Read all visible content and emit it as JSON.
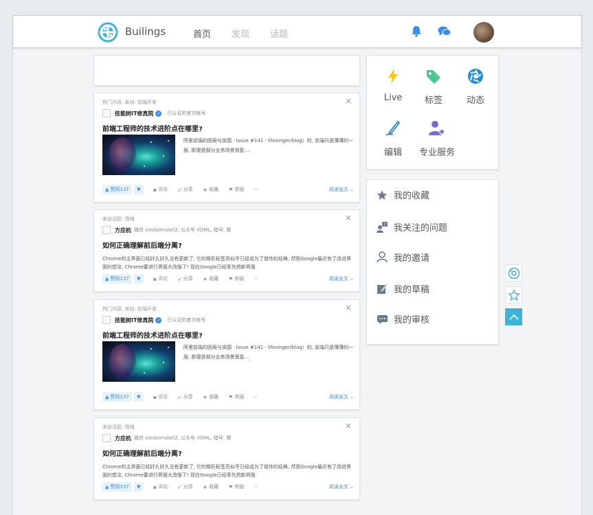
{
  "header": {
    "brand": "Builings",
    "nav": [
      "首页",
      "发现",
      "话题"
    ],
    "icons": [
      "bell-icon",
      "chat-icon"
    ],
    "accent": "#3cb3d9"
  },
  "feed": [
    {
      "meta": "热门内容, 来自: 前端开发",
      "author": "技能树IT修真院",
      "author_desc": "已认证的官方帐号",
      "title": "前端工程师的技术进阶点在哪里?",
      "excerpt": "阿里前端的困局与突围 · Issue #141 · lifesinger/blog）的, 前端只是薄薄的一层, 即便是部分业务场景很复…",
      "has_image": true,
      "vote": "赞同137",
      "comment": "评论",
      "share": "分享",
      "favorite": "收藏",
      "report": "举报",
      "more": "···",
      "read_all": "阅读全文"
    },
    {
      "meta": "来自话题: 情绪",
      "author": "方应杭",
      "author_desc": "微信 xiedaimala02, 公众号 XDML, 暗号: 飓",
      "title": "如何正确理解前后端分离?",
      "excerpt": "Chrome的主界面已经好久好久没有更新了, 它的梯形标签页似乎已经成为了祖传的经典, 然而Google最近有了改进界面的想法, Chrome要进行界面大改版了! 现在Google已经率先把新界面",
      "has_image": false,
      "vote": "赞同137",
      "comment": "评论",
      "share": "分享",
      "favorite": "收藏",
      "report": "举报",
      "more": "···",
      "read_all": "阅读全文"
    },
    {
      "meta": "热门内容, 来自: 前端开发",
      "author": "技能树IT修真院",
      "author_desc": "已认证的官方帐号",
      "title": "前端工程师的技术进阶点在哪里?",
      "excerpt": "阿里前端的困局与突围 · Issue #141 · lifesinger/blog）的, 前端只是薄薄的一层, 即便是部分业务场景很复…",
      "has_image": true,
      "vote": "赞同137",
      "comment": "评论",
      "share": "分享",
      "favorite": "收藏",
      "report": "举报",
      "more": "···",
      "read_all": "阅读全文"
    },
    {
      "meta": "来自话题: 情绪",
      "author": "方应杭",
      "author_desc": "微信 xiedaimala02, 公众号 XDML, 暗号: 飓",
      "title": "如何正确理解前后端分离?",
      "excerpt": "Chrome的主界面已经好久好久没有更新了, 它的梯形标签页似乎已经成为了祖传的经典, 然而Google最近有了改进界面的想法, Chrome要进行界面大改版了! 现在Google已经率先把新界面",
      "has_image": false,
      "vote": "赞同137",
      "comment": "评论",
      "share": "分享",
      "favorite": "收藏",
      "report": "举报",
      "more": "···",
      "read_all": "阅读全文"
    }
  ],
  "tools": [
    {
      "label": "Live",
      "icon": "lightning-icon",
      "color": "#f5c518"
    },
    {
      "label": "标签",
      "icon": "tag-icon",
      "color": "#4cc790"
    },
    {
      "label": "动态",
      "icon": "aperture-icon",
      "color": "#1e8fe0"
    },
    {
      "label": "编辑",
      "icon": "pen-icon",
      "color": "#2a7fd1"
    },
    {
      "label": "专业服务",
      "icon": "user-star-icon",
      "color": "#6b6fd6"
    }
  ],
  "menu": [
    {
      "label": "我的收藏",
      "icon": "star-icon"
    },
    {
      "label": "我关注的问题",
      "icon": "question-user-icon"
    },
    {
      "label": "我的邀请",
      "icon": "person-icon"
    },
    {
      "label": "我的草稿",
      "icon": "edit-icon"
    },
    {
      "label": "我的审核",
      "icon": "comment-icon"
    }
  ],
  "side_buttons": [
    "disc-icon",
    "star-outline-icon",
    "back-to-top-icon"
  ]
}
